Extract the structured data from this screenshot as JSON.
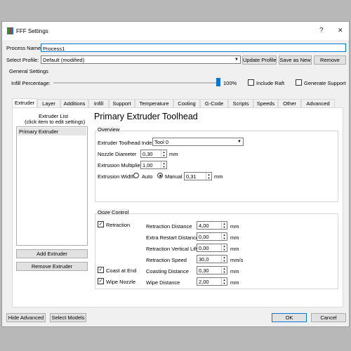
{
  "window": {
    "title": "FFF Settings",
    "help_glyph": "?",
    "close_glyph": "✕"
  },
  "process_name": {
    "label": "Process Name:",
    "value": "Process1"
  },
  "profile": {
    "label": "Select Profile:",
    "value": "Default (modified)"
  },
  "buttons": {
    "update_profile": "Update Profile",
    "save_as_new": "Save as New",
    "remove": "Remove"
  },
  "general": {
    "title": "General Settings",
    "infill_label": "Infill Percentage:",
    "infill_value": "100%",
    "infill_level": 1.0,
    "include_raft": "Include Raft",
    "include_raft_checked": false,
    "generate_support": "Generate Support",
    "generate_support_checked": false
  },
  "tabs": [
    "Extruder",
    "Layer",
    "Additions",
    "Infill",
    "Support",
    "Temperature",
    "Cooling",
    "G-Code",
    "Scripts",
    "Speeds",
    "Other",
    "Advanced"
  ],
  "extruder_list": {
    "title_line1": "Extruder List",
    "title_line2": "(click item to edit settings)",
    "items": [
      "Primary Extruder"
    ],
    "add": "Add Extruder",
    "remove": "Remove Extruder"
  },
  "toolhead": {
    "heading": "Primary Extruder Toolhead",
    "overview_title": "Overview",
    "index_label": "Extruder Toolhead Index",
    "index_value": "Tool 0",
    "nozzle_label": "Nozzle Diameter",
    "nozzle_value": "0,30",
    "nozzle_unit": "mm",
    "multiplier_label": "Extrusion Multiplier",
    "multiplier_value": "1,00",
    "width_label": "Extrusion Width",
    "width_auto": "Auto",
    "width_manual": "Manual",
    "width_value": "0,31",
    "width_unit": "mm"
  },
  "ooze": {
    "title": "Ooze Control",
    "retraction": "Retraction",
    "coast": "Coast at End",
    "wipe": "Wipe Nozzle",
    "fields": [
      {
        "label": "Retraction Distance",
        "value": "4,00",
        "unit": "mm"
      },
      {
        "label": "Extra Restart Distance",
        "value": "0,00",
        "unit": "mm"
      },
      {
        "label": "Retraction Vertical Lift",
        "value": "0,00",
        "unit": "mm"
      },
      {
        "label": "Retraction Speed",
        "value": "30,0",
        "unit": "mm/s"
      },
      {
        "label": "Coasting Distance",
        "value": "0,30",
        "unit": "mm"
      },
      {
        "label": "Wipe Distance",
        "value": "2,00",
        "unit": "mm"
      }
    ]
  },
  "footer": {
    "hide_advanced": "Hide Advanced",
    "select_models": "Select Models",
    "ok": "OK",
    "cancel": "Cancel"
  },
  "colors": {
    "accent": "#0078d7",
    "panel_bg": "#ffffff",
    "window_bg": "#f0f0f0"
  }
}
